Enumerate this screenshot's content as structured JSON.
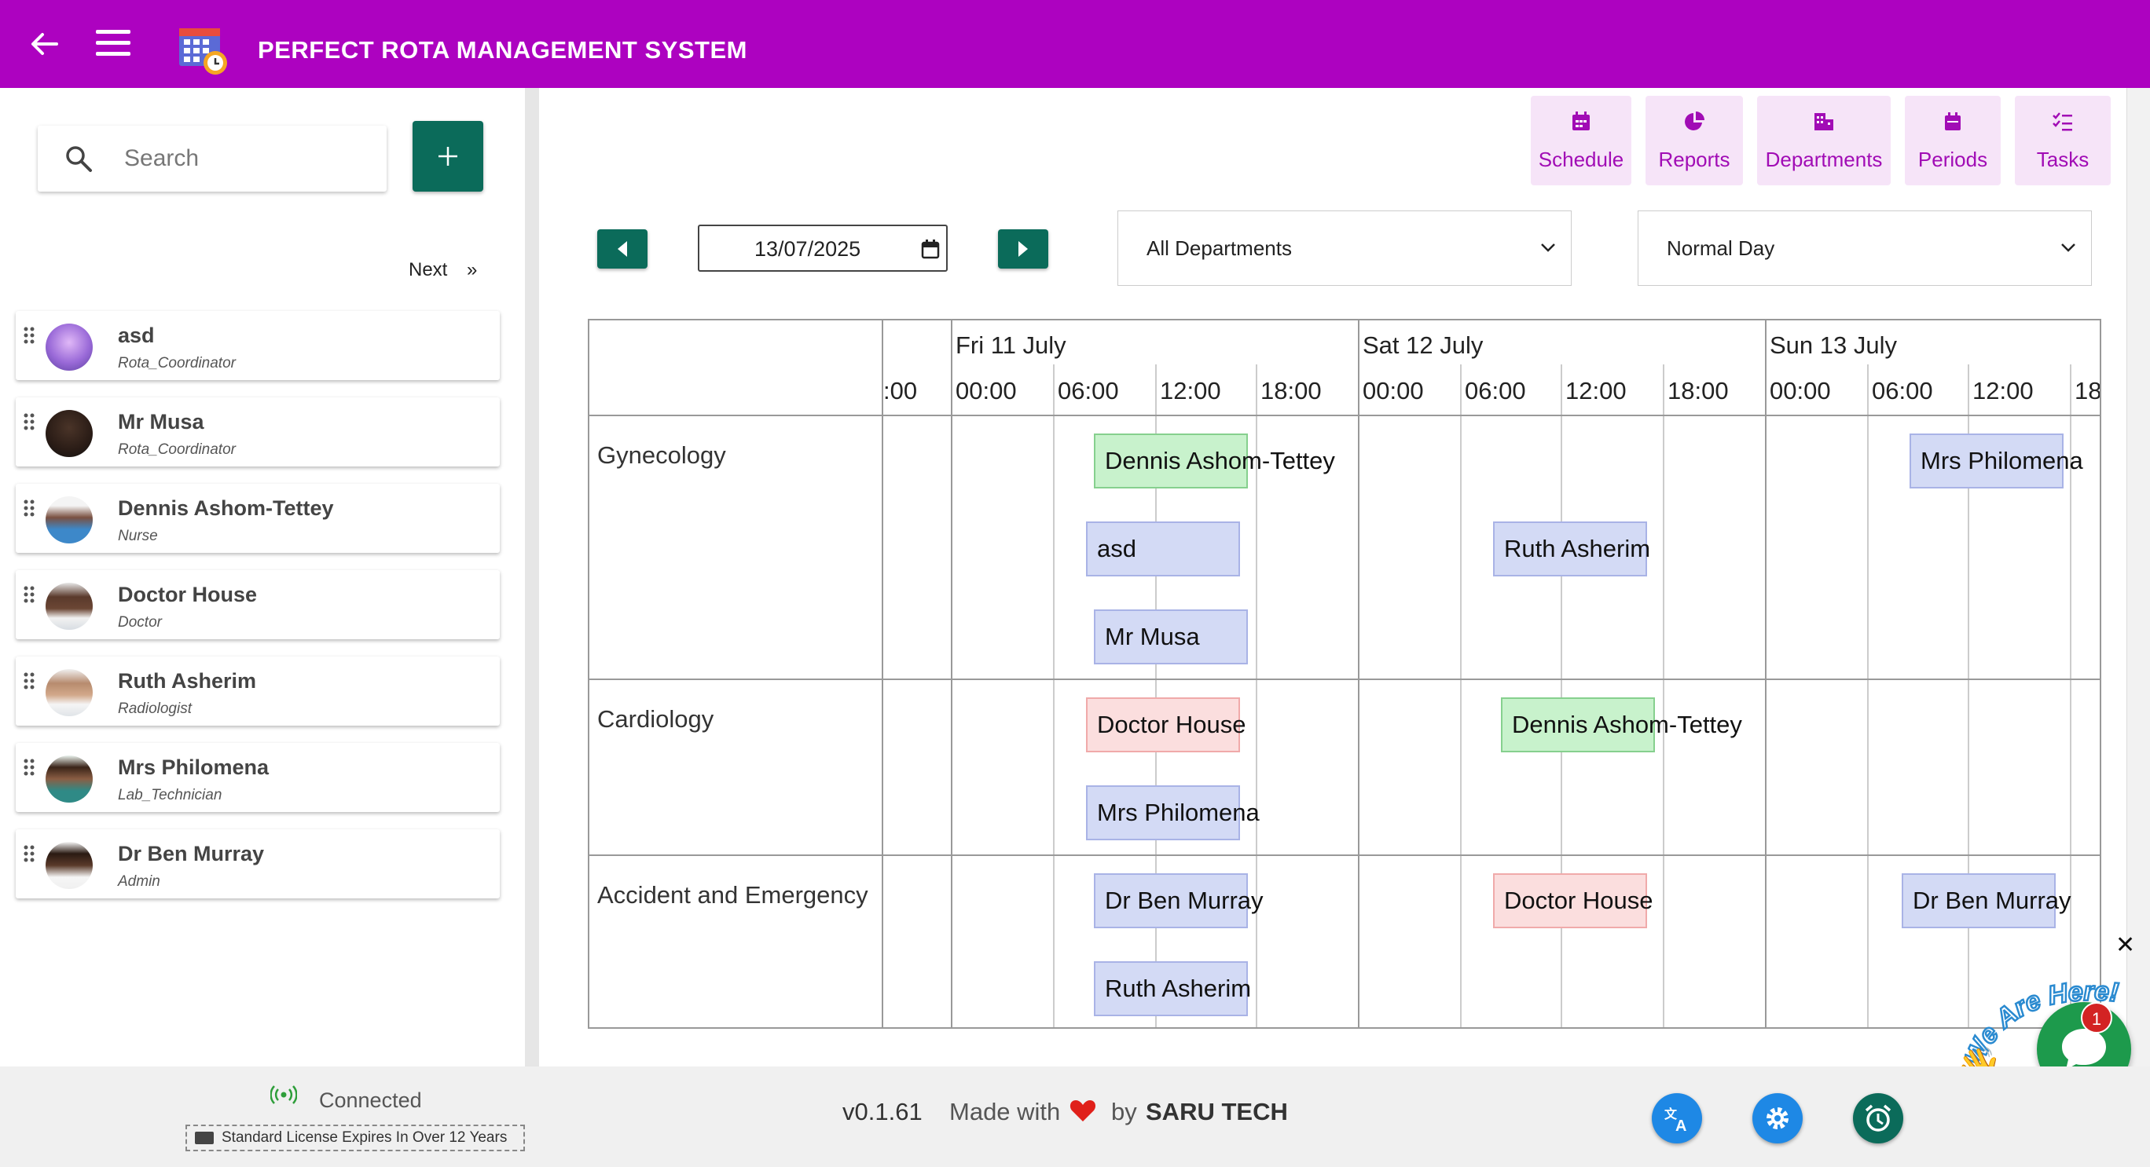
{
  "header": {
    "title": "PERFECT ROTA MANAGEMENT SYSTEM",
    "back_icon": "back-arrow-icon",
    "menu_icon": "hamburger-menu-icon",
    "logo": "calendar-clock-logo"
  },
  "sidebar": {
    "search": {
      "placeholder": "Search"
    },
    "add_button": "+",
    "next_label": "Next",
    "next_arrow": "»",
    "staff": [
      {
        "name": "asd",
        "role": "Rota_Coordinator"
      },
      {
        "name": "Mr Musa",
        "role": "Rota_Coordinator"
      },
      {
        "name": "Dennis Ashom-Tettey",
        "role": "Nurse"
      },
      {
        "name": "Doctor House",
        "role": "Doctor"
      },
      {
        "name": "Ruth Asherim",
        "role": "Radiologist"
      },
      {
        "name": "Mrs Philomena",
        "role": "Lab_Technician"
      },
      {
        "name": "Dr Ben Murray",
        "role": "Admin"
      }
    ]
  },
  "toolbar": {
    "buttons": [
      {
        "label": "Schedule",
        "icon": "calendar-icon"
      },
      {
        "label": "Reports",
        "icon": "pie-chart-icon"
      },
      {
        "label": "Departments",
        "icon": "building-icon"
      },
      {
        "label": "Periods",
        "icon": "calendar-small-icon"
      },
      {
        "label": "Tasks",
        "icon": "checklist-icon"
      }
    ]
  },
  "controls": {
    "date_value": "13/07/2025",
    "department_select": "All Departments",
    "day_type_select": "Normal Day"
  },
  "timeline": {
    "partial_time": ":00",
    "days": [
      {
        "label": "Fri 11 July",
        "times": [
          "00:00",
          "06:00",
          "12:00",
          "18:00"
        ]
      },
      {
        "label": "Sat 12 July",
        "times": [
          "00:00",
          "06:00",
          "12:00",
          "18:00"
        ]
      },
      {
        "label": "Sun 13 July",
        "times": [
          "00:00",
          "06:00",
          "12:00",
          "18"
        ]
      }
    ],
    "departments": [
      "Gynecology",
      "Cardiology",
      "Accident and Emergency"
    ],
    "shifts": [
      {
        "name": "Dennis Ashom-Tettey",
        "color": "green"
      },
      {
        "name": "asd",
        "color": "blue"
      },
      {
        "name": "Mr Musa",
        "color": "blue"
      },
      {
        "name": "Ruth Asherim",
        "color": "blue"
      },
      {
        "name": "Mrs Philomena",
        "color": "blue"
      },
      {
        "name": "Doctor House",
        "color": "pink"
      },
      {
        "name": "Mrs Philomena",
        "color": "blue"
      },
      {
        "name": "Dennis Ashom-Tettey",
        "color": "green"
      },
      {
        "name": "Dr Ben Murray",
        "color": "blue"
      },
      {
        "name": "Ruth Asherim",
        "color": "blue"
      },
      {
        "name": "Doctor House",
        "color": "pink"
      },
      {
        "name": "Dr Ben Murray",
        "color": "blue"
      }
    ]
  },
  "chat": {
    "badge": "1",
    "banner": "We Are Here!",
    "close": "✕"
  },
  "footer": {
    "status": "Connected",
    "license": "Standard License Expires In Over 12 Years",
    "version": "v0.1.61",
    "made_with": "Made with",
    "by": "by",
    "company": "SARU TECH"
  },
  "colors": {
    "brand": "#ad02c0",
    "accent": "#0b6b5a",
    "fab_blue": "#1e88e5",
    "chat_green": "#1d9a4c"
  }
}
